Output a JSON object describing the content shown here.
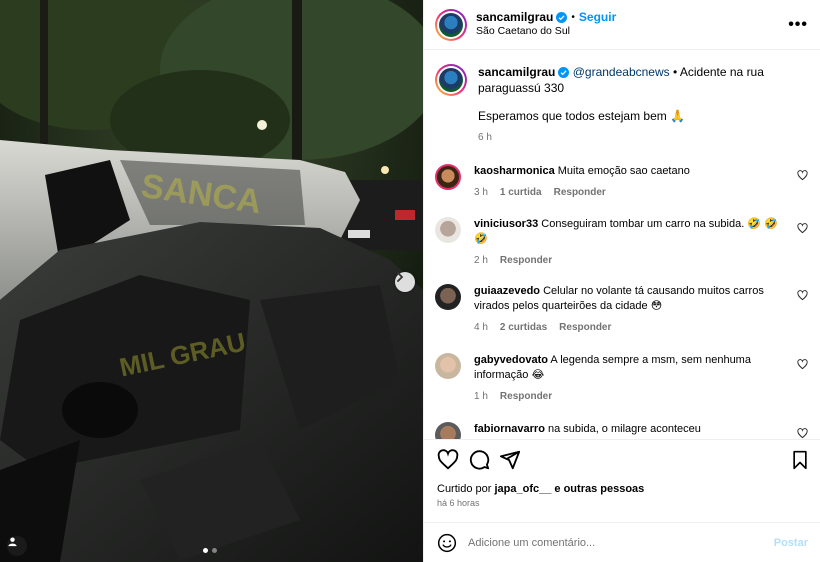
{
  "post": {
    "author": "sancamilgrau",
    "follow_label": "Seguir",
    "separator": "•",
    "location": "São Caetano do Sul",
    "more_icon": "more-options-icon"
  },
  "photo": {
    "watermark_top": "SANCA",
    "watermark_bottom": "MIL GRAU",
    "slide_index": 1,
    "slide_count": 2
  },
  "caption": {
    "author": "sancamilgrau",
    "mention": "@grandeabcnews",
    "text_a": " • Acidente na rua paraguassú 330",
    "text_b": "Esperamos que todos estejam bem 🙏",
    "time": "6 h"
  },
  "comments": [
    {
      "user": "kaosharmonica",
      "text": "Muita emoção sao caetano",
      "time": "3 h",
      "likes": "1 curtida",
      "reply": "Responder"
    },
    {
      "user": "viniciusor33",
      "text": "Conseguiram tombar um carro na subida. 🤣 🤣 🤣",
      "time": "2 h",
      "likes": "",
      "reply": "Responder"
    },
    {
      "user": "guiaazevedo",
      "text": "Celular no volante tá causando muitos carros virados pelos quarteirões da cidade 😳",
      "time": "4 h",
      "likes": "2 curtidas",
      "reply": "Responder"
    },
    {
      "user": "gabyvedovato",
      "text": "A legenda sempre a msm, sem nenhuma informação 😂",
      "time": "1 h",
      "likes": "",
      "reply": "Responder"
    },
    {
      "user": "fabiornavarro",
      "text": "na subida, o milagre aconteceu",
      "time": "",
      "likes": "",
      "reply": ""
    }
  ],
  "likes_line": {
    "prefix": "Curtido por ",
    "user": "japa_ofc__",
    "suffix": " e outras pessoas"
  },
  "posted": "há 6 horas",
  "add_comment": {
    "placeholder": "Adicione um comentário...",
    "post_label": "Postar"
  },
  "colors": {
    "accent": "#0095f6",
    "muted": "#737373",
    "mention": "#00376b",
    "post_disabled": "#b2dffc"
  }
}
